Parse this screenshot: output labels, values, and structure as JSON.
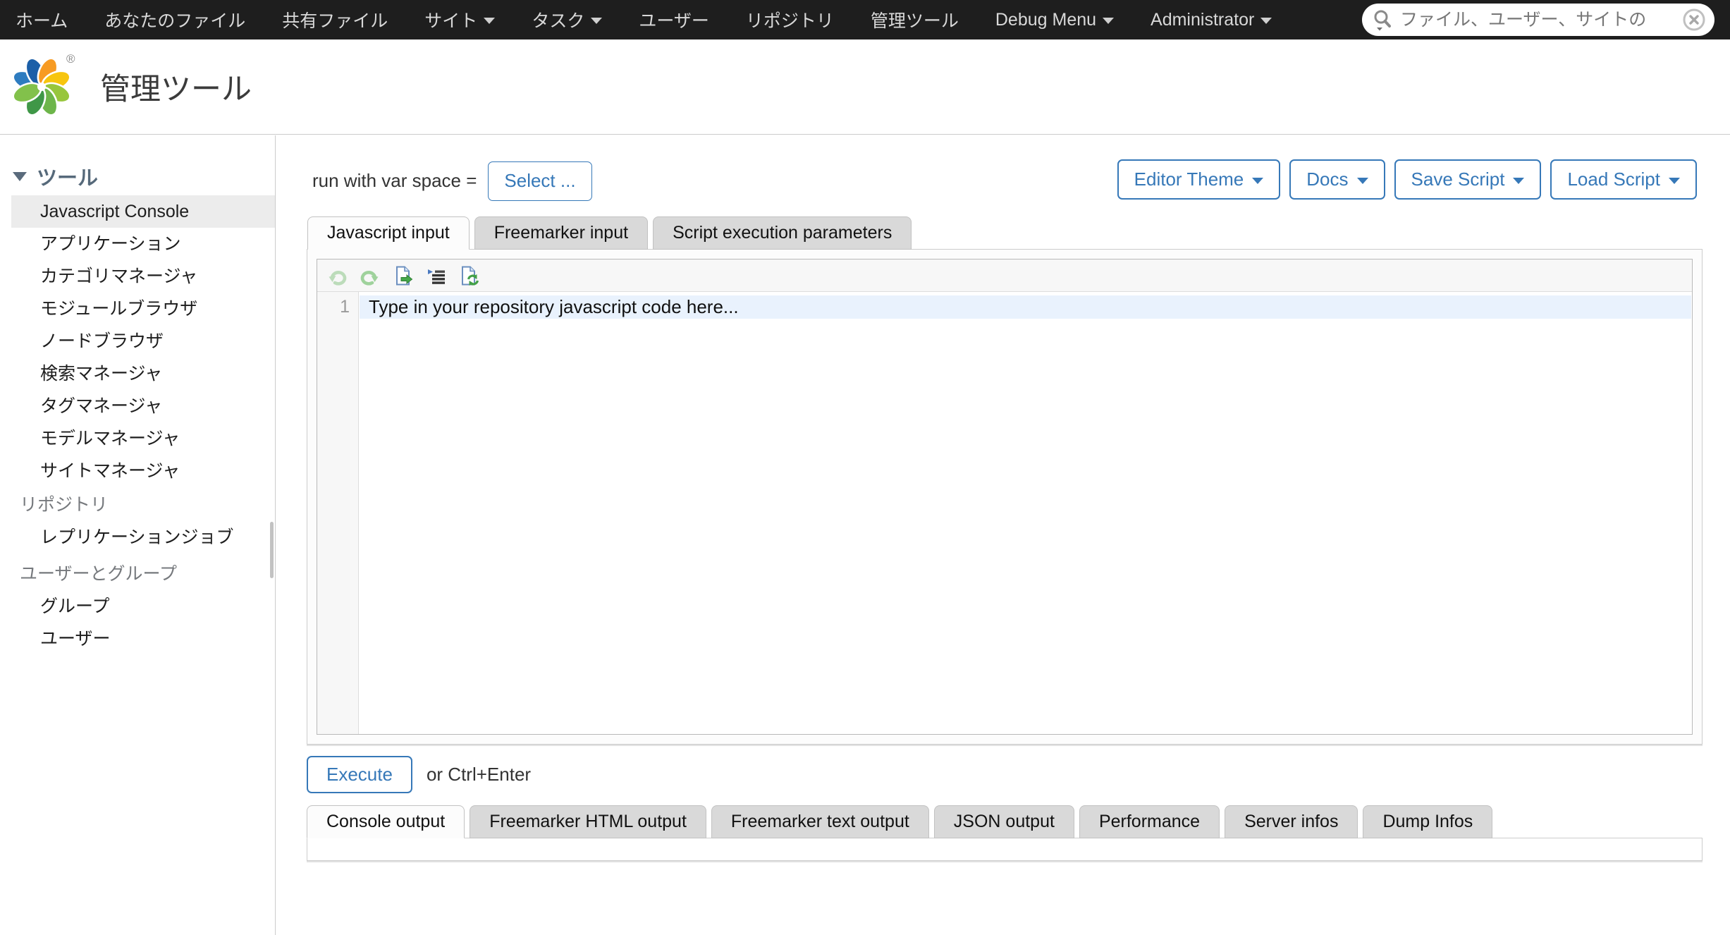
{
  "colors": {
    "nav_bg": "#1e1e1e",
    "accent_blue": "#3678b8",
    "sidebar_header": "#56697a",
    "active_row_bg": "#ececec",
    "line_highlight": "#e9f2fd",
    "tab_inactive_bg": "#d9d9d9"
  },
  "nav": {
    "items": [
      {
        "label": "ホーム"
      },
      {
        "label": "あなたのファイル"
      },
      {
        "label": "共有ファイル"
      },
      {
        "label": "サイト",
        "has_caret": true
      },
      {
        "label": "タスク",
        "has_caret": true
      },
      {
        "label": "ユーザー"
      },
      {
        "label": "リポジトリ"
      },
      {
        "label": "管理ツール"
      },
      {
        "label": "Debug Menu",
        "has_caret": true
      },
      {
        "label": "Administrator",
        "has_caret": true
      }
    ],
    "search": {
      "placeholder": "ファイル、ユーザー、サイトの",
      "icon": "search-icon",
      "clear_icon": "clear-circle-icon"
    }
  },
  "header": {
    "logo": "alfresco-flower-logo",
    "registered_mark": "®",
    "title": "管理ツール"
  },
  "sidebar": {
    "tools_section": {
      "label": "ツール",
      "collapse_icon": "triangle-down-icon"
    },
    "tools_items": [
      "Javascript Console",
      "アプリケーション",
      "カテゴリマネージャ",
      "モジュールブラウザ",
      "ノードブラウザ",
      "検索マネージャ",
      "タグマネージャ",
      "モデルマネージャ",
      "サイトマネージャ"
    ],
    "active_item": "Javascript Console",
    "repository_section": {
      "label": "リポジトリ"
    },
    "repository_items": [
      "レプリケーションジョブ"
    ],
    "users_groups_section": {
      "label": "ユーザーとグループ"
    },
    "users_groups_items": [
      "グループ",
      "ユーザー"
    ]
  },
  "console": {
    "var_space_label": "run with var space =",
    "select_button": "Select ...",
    "menu_buttons": [
      "Editor Theme",
      "Docs",
      "Save Script",
      "Load Script"
    ],
    "input_tabs": [
      "Javascript input",
      "Freemarker input",
      "Script execution parameters"
    ],
    "active_input_tab": "Javascript input",
    "editor_toolbar_icons": [
      "undo-icon",
      "redo-icon",
      "load-document-icon",
      "indent-icon",
      "reload-document-icon"
    ],
    "editor": {
      "line_number": "1",
      "code_placeholder": "Type in your repository javascript code here..."
    },
    "execute_button": "Execute",
    "execute_hint": "or Ctrl+Enter",
    "output_tabs": [
      "Console output",
      "Freemarker HTML output",
      "Freemarker text output",
      "JSON output",
      "Performance",
      "Server infos",
      "Dump Infos"
    ],
    "active_output_tab": "Console output"
  }
}
